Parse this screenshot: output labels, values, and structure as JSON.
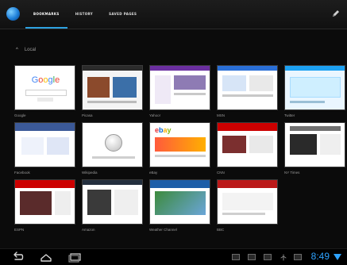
{
  "app": {
    "tabs": [
      {
        "label": "BOOKMARKS"
      },
      {
        "label": "HISTORY"
      },
      {
        "label": "SAVED PAGES"
      }
    ]
  },
  "section": {
    "title": "Local"
  },
  "bookmarks": [
    {
      "title": "Google",
      "accent": "#ffffff"
    },
    {
      "title": "Picasa",
      "accent": "#2b2b2b"
    },
    {
      "title": "Yahoo!",
      "accent": "#f2f2f2"
    },
    {
      "title": "MSN",
      "accent": "#f5f5f5"
    },
    {
      "title": "Twitter",
      "accent": "#d7efff"
    },
    {
      "title": "Facebook",
      "accent": "#3b5998"
    },
    {
      "title": "Wikipedia",
      "accent": "#ffffff"
    },
    {
      "title": "eBay",
      "accent": "#ffffff"
    },
    {
      "title": "CNN",
      "accent": "#cc0000"
    },
    {
      "title": "NY Times",
      "accent": "#ffffff"
    },
    {
      "title": "ESPN",
      "accent": "#cc0000"
    },
    {
      "title": "Amazon",
      "accent": "#ffffff"
    },
    {
      "title": "Weather Channel",
      "accent": "#1d5ea8"
    },
    {
      "title": "BBC",
      "accent": "#bb1919"
    }
  ],
  "status": {
    "time": "8:49"
  }
}
